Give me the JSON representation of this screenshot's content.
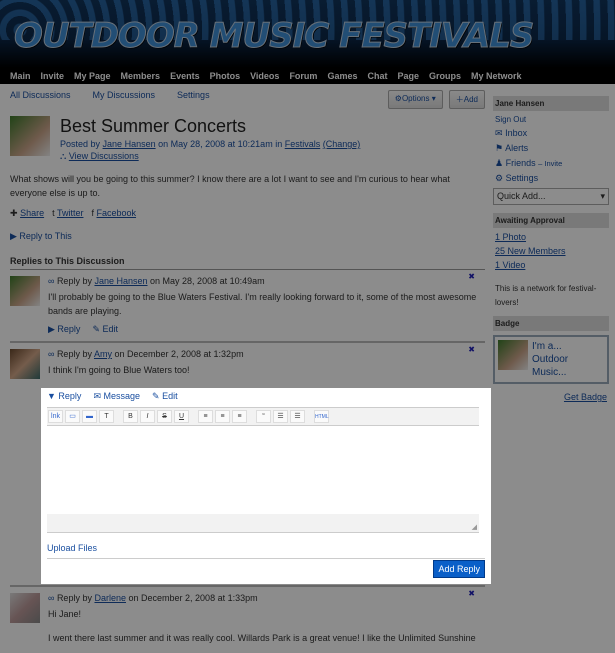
{
  "site_title": "OUTDOOR MUSIC FESTIVALS",
  "nav": [
    "Main",
    "Invite",
    "My Page",
    "Members",
    "Events",
    "Photos",
    "Videos",
    "Forum",
    "Games",
    "Chat",
    "Page",
    "Groups",
    "My Network"
  ],
  "subnav": [
    "All Discussions",
    "My Discussions",
    "Settings"
  ],
  "buttons": {
    "options": "Options",
    "add": "Add"
  },
  "discussion": {
    "title": "Best Summer Concerts",
    "posted_by": "Posted by",
    "author": "Jane Hansen",
    "date": "on May 28, 2008 at 10:21am in",
    "category": "Festivals",
    "change": "(Change)",
    "view": "View Discussions",
    "body": "What shows will you be going to this summer? I know there are a lot I want to see and I'm curious to hear what everyone else is up to.",
    "share": [
      "Share",
      "Twitter",
      "Facebook"
    ],
    "reply_to": "Reply to This"
  },
  "replies_heading": "Replies to This Discussion",
  "replies": [
    {
      "prefix": "Reply by",
      "author": "Jane Hansen",
      "date": "on May 28, 2008 at 10:49am",
      "body": "I'll probably be going to the Blue Waters Festival. I'm really looking forward to it, some of the most awesome bands are playing.",
      "reply": "Reply",
      "edit": "Edit"
    },
    {
      "prefix": "Reply by",
      "author": "Amy",
      "date": "on December 2, 2008 at 1:32pm",
      "body": "I think I'm going to Blue Waters too!"
    },
    {
      "prefix": "Reply by",
      "author": "Darlene",
      "date": "on December 2, 2008 at 1:33pm",
      "body": "Hi Jane!",
      "body2": "I went there last summer and it was really cool. Willards Park is a great venue! I like the Unlimited Sunshine"
    }
  ],
  "editor": {
    "tabs": [
      "Reply",
      "Message",
      "Edit"
    ],
    "toolbar": [
      "Link",
      "Image",
      "Video",
      "Text",
      "B",
      "I",
      "S",
      "U",
      "Left",
      "Center",
      "Right",
      "“",
      "Bullets",
      "Numbers",
      "HTML"
    ],
    "upload": "Upload Files",
    "submit": "Add Reply"
  },
  "sidebar": {
    "user": "Jane Hansen",
    "sign_out": "Sign Out",
    "links": [
      "Inbox",
      "Alerts",
      "Friends",
      "Settings"
    ],
    "invite": "– Invite",
    "quick_add": "Quick Add...",
    "awaiting": "Awaiting Approval",
    "approval": [
      "1 Photo",
      "25 New Members",
      "1 Video"
    ],
    "about": "This is a network for festival-lovers!",
    "badge_h": "Badge",
    "badge": [
      "I'm a...",
      "Outdoor",
      "Music..."
    ],
    "get_badge": "Get Badge"
  }
}
